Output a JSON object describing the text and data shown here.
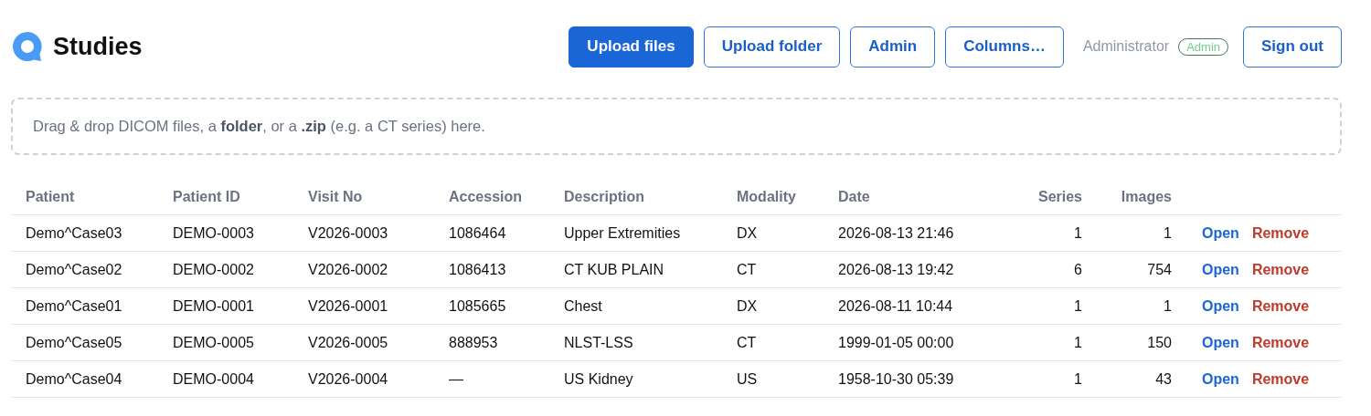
{
  "header": {
    "title": "Studies",
    "buttons": [
      {
        "label": "Upload files",
        "kind": "primary"
      },
      {
        "label": "Upload folder",
        "kind": "outline"
      },
      {
        "label": "Admin",
        "kind": "outline"
      },
      {
        "label": "Columns…",
        "kind": "outline"
      }
    ],
    "user": {
      "name": "Administrator",
      "role": "Admin"
    },
    "sign_out": "Sign out"
  },
  "dropzone": {
    "text": "Drag & drop DICOM files, a **folder**, or a **.zip** (e.g. a CT series) here."
  },
  "table": {
    "columns": [
      "Patient",
      "Patient ID",
      "Visit No",
      "Accession",
      "Description",
      "Modality",
      "Date",
      "Series",
      "Images"
    ],
    "rows": [
      {
        "cells": [
          "Demo^Case03",
          "DEMO-0003",
          "V2026-0003",
          "1086464",
          "Upper Extremities",
          "DX",
          "2026-08-13 21:46",
          "1",
          "1"
        ],
        "actions": [
          "Open",
          "Remove"
        ]
      },
      {
        "cells": [
          "Demo^Case02",
          "DEMO-0002",
          "V2026-0002",
          "1086413",
          "CT KUB PLAIN",
          "CT",
          "2026-08-13 19:42",
          "6",
          "754"
        ],
        "actions": [
          "Open",
          "Remove"
        ]
      },
      {
        "cells": [
          "Demo^Case01",
          "DEMO-0001",
          "V2026-0001",
          "1085665",
          "Chest",
          "DX",
          "2026-08-11 10:44",
          "1",
          "1"
        ],
        "actions": [
          "Open",
          "Remove"
        ]
      },
      {
        "cells": [
          "Demo^Case05",
          "DEMO-0005",
          "V2026-0005",
          "888953",
          "NLST-LSS",
          "CT",
          "1999-01-05 00:00",
          "1",
          "150"
        ],
        "actions": [
          "Open",
          "Remove"
        ]
      },
      {
        "cells": [
          "Demo^Case04",
          "DEMO-0004",
          "V2026-0004",
          "—",
          "US Kidney",
          "US",
          "1958-10-30 05:39",
          "1",
          "43"
        ],
        "actions": [
          "Open",
          "Remove"
        ]
      }
    ]
  }
}
